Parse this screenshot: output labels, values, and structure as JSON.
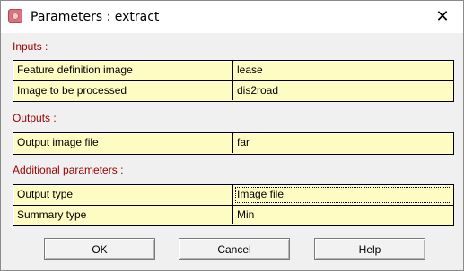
{
  "window": {
    "title": "Parameters : extract",
    "close_glyph": "✕"
  },
  "sections": {
    "inputs": {
      "label": "Inputs :",
      "rows": [
        {
          "name": "Feature definition image",
          "value": "lease"
        },
        {
          "name": "Image to be processed",
          "value": "dis2road"
        }
      ]
    },
    "outputs": {
      "label": "Outputs :",
      "rows": [
        {
          "name": "Output image file",
          "value": "far"
        }
      ]
    },
    "additional": {
      "label": "Additional parameters :",
      "rows": [
        {
          "name": "Output type",
          "value": "Image file"
        },
        {
          "name": "Summary type",
          "value": "Min"
        }
      ]
    }
  },
  "buttons": {
    "ok": "OK",
    "cancel": "Cancel",
    "help": "Help"
  },
  "colors": {
    "section_label": "#990000",
    "grid_fill": "#fffcc3"
  },
  "icons": {
    "app": "idrisi-app-icon",
    "close": "close-icon"
  }
}
